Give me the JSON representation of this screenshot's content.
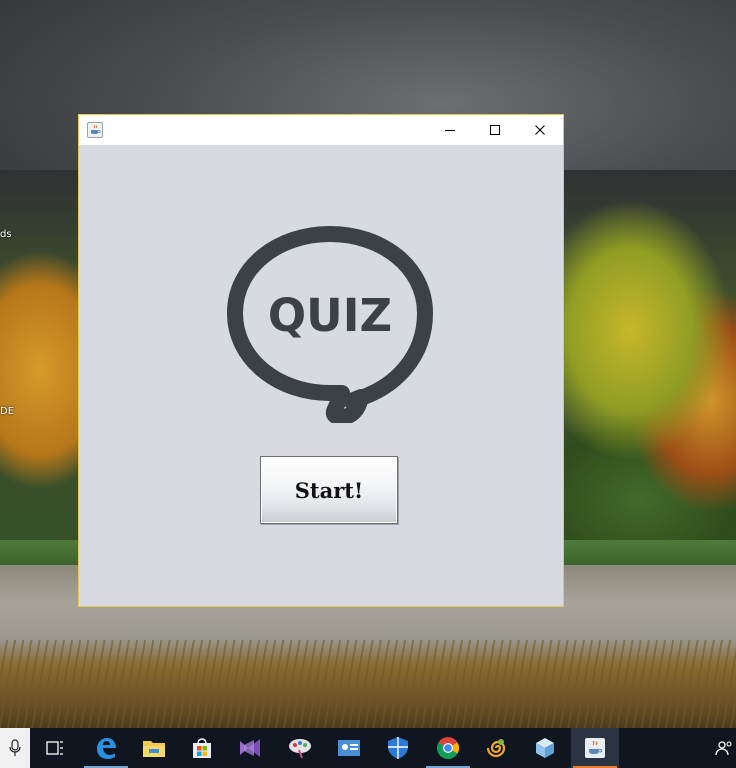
{
  "desktop": {
    "labels": [
      "ds",
      "DE"
    ]
  },
  "window": {
    "icon": "java-coffee-icon",
    "controls": {
      "minimize_icon": "minimize-icon",
      "maximize_icon": "maximize-icon",
      "close_icon": "close-icon"
    }
  },
  "content": {
    "logo_text": "QUIZ",
    "start_label": "Start!"
  },
  "taskbar": {
    "items": [
      {
        "icon": "microphone-icon"
      },
      {
        "icon": "task-view-icon"
      },
      {
        "icon": "edge-browser-icon"
      },
      {
        "icon": "file-explorer-icon"
      },
      {
        "icon": "microsoft-store-icon"
      },
      {
        "icon": "visual-studio-icon"
      },
      {
        "icon": "paint-app-icon"
      },
      {
        "icon": "contact-card-app-icon"
      },
      {
        "icon": "shield-app-icon"
      },
      {
        "icon": "chrome-browser-icon"
      },
      {
        "icon": "spiral-app-icon"
      },
      {
        "icon": "cube-app-icon"
      },
      {
        "icon": "java-app-icon",
        "active": true
      },
      {
        "icon": "people-icon"
      }
    ]
  },
  "colors": {
    "window_bg": "#d7dbe1",
    "window_border": "#e3c94c",
    "logo": "#3a4147",
    "taskbar": "#0f1620",
    "active_indicator": "#e67a2e"
  }
}
